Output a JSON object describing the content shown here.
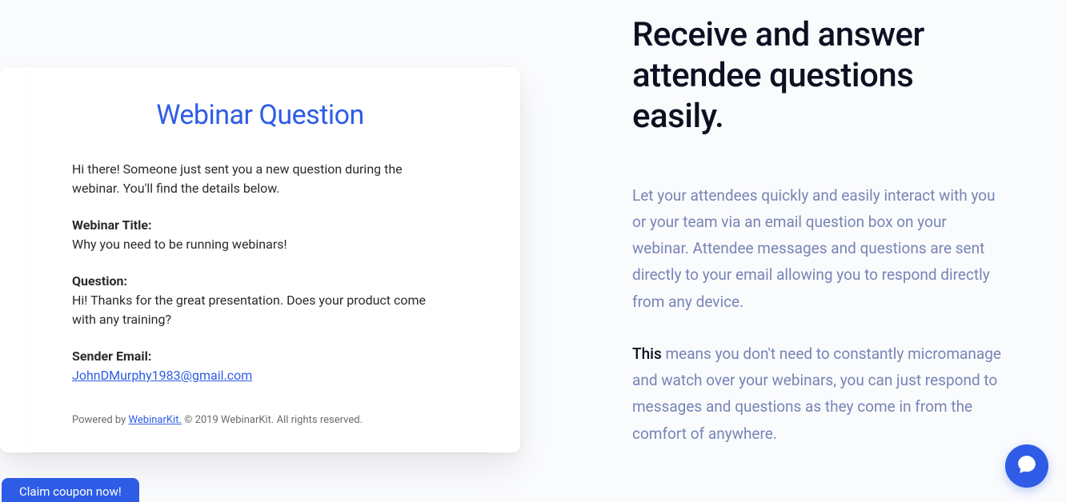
{
  "email": {
    "title": "Webinar Question",
    "intro": "Hi there! Someone just sent you a new question during the webinar. You'll find the details below.",
    "webinar_title_label": "Webinar Title:",
    "webinar_title_value": "Why you need to be running webinars!",
    "question_label": "Question:",
    "question_value": "Hi! Thanks for the great presentation. Does your product come with any training?",
    "sender_label": "Sender Email:",
    "sender_value": "JohnDMurphy1983@gmail.com",
    "footer_prefix": "Powered by ",
    "footer_link": "WebinarKit.",
    "footer_suffix": " © 2019 WebinarKit. All rights reserved."
  },
  "feature": {
    "heading": "Receive and answer attendee questions easily.",
    "paragraph1": "Let your attendees quickly and easily interact with you or your team via an email question box on your webinar. Attendee messages and questions are sent directly to your email allowing you to respond directly from any device.",
    "paragraph2_bold": "This",
    "paragraph2_rest": " means you don't need to constantly micromanage and watch over your webinars, you can just respond to messages and questions as they come in from the comfort of anywhere."
  },
  "coupon": {
    "label": "Claim coupon now!"
  }
}
